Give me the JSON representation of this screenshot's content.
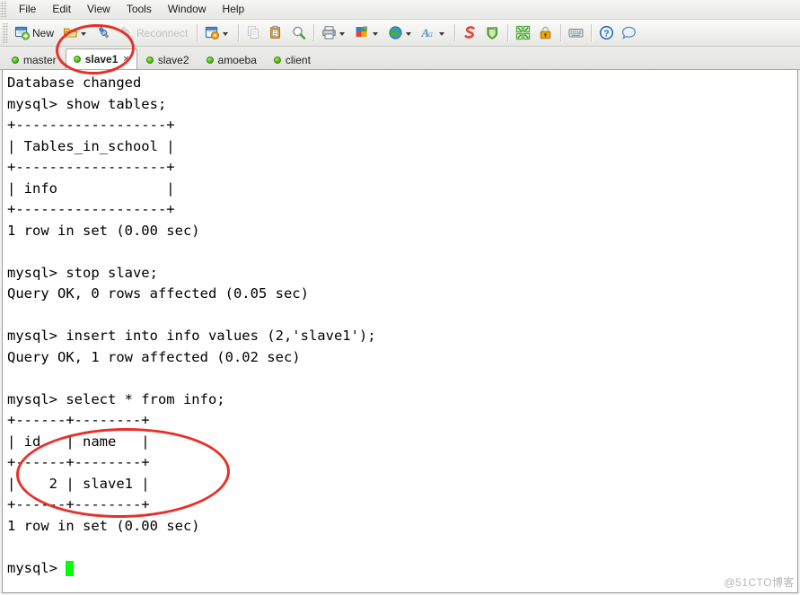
{
  "menubar": {
    "items": [
      {
        "label": "File"
      },
      {
        "label": "Edit"
      },
      {
        "label": "View"
      },
      {
        "label": "Tools"
      },
      {
        "label": "Window"
      },
      {
        "label": "Help"
      }
    ]
  },
  "toolbar": {
    "new_label": "New",
    "reconnect_label": "Reconnect",
    "icons": [
      "new-session-icon",
      "open-folder-icon",
      "connect-icon",
      "reconnect-icon",
      "properties-icon",
      "copy-icon",
      "paste-icon",
      "find-icon",
      "print-icon",
      "color-scheme-icon",
      "globe-icon",
      "font-icon",
      "script-icon",
      "shield-icon",
      "fullscreen-icon",
      "lock-icon",
      "keyboard-icon",
      "help-icon",
      "chat-icon"
    ]
  },
  "tabs": [
    {
      "label": "master",
      "active": false,
      "status": "connected"
    },
    {
      "label": "slave1",
      "active": true,
      "status": "connected",
      "close": "×"
    },
    {
      "label": "slave2",
      "active": false,
      "status": "connected"
    },
    {
      "label": "amoeba",
      "active": false,
      "status": "connected"
    },
    {
      "label": "client",
      "active": false,
      "status": "connected"
    }
  ],
  "terminal": {
    "prompt": "mysql> ",
    "lines": [
      "Database changed",
      "mysql> show tables;",
      "+------------------+",
      "| Tables_in_school |",
      "+------------------+",
      "| info             |",
      "+------------------+",
      "1 row in set (0.00 sec)",
      "",
      "mysql> stop slave;",
      "Query OK, 0 rows affected (0.05 sec)",
      "",
      "mysql> insert into info values (2,'slave1');",
      "Query OK, 1 row affected (0.02 sec)",
      "",
      "mysql> select * from info;",
      "+------+--------+",
      "| id   | name   |",
      "+------+--------+",
      "|    2 | slave1 |",
      "+------+--------+",
      "1 row in set (0.00 sec)",
      "",
      "mysql> "
    ],
    "text": "Database changed\nmysql> show tables;\n+------------------+\n| Tables_in_school |\n+------------------+\n| info             |\n+------------------+\n1 row in set (0.00 sec)\n\nmysql> stop slave;\nQuery OK, 0 rows affected (0.05 sec)\n\nmysql> insert into info values (2,'slave1');\nQuery OK, 1 row affected (0.02 sec)\n\nmysql> select * from info;\n+------+--------+\n| id   | name   |\n+------+--------+\n|    2 | slave1 |\n+------+--------+\n1 row in set (0.00 sec)\n\nmysql> ",
    "cursor_color": "#00ff00",
    "foreground": "#000000",
    "background": "#ffffff"
  },
  "annotations": [
    {
      "name": "tab-highlight",
      "color": "#e8302a",
      "shape": "ellipse"
    },
    {
      "name": "result-table-highlight",
      "color": "#e8302a",
      "shape": "ellipse"
    }
  ],
  "watermark": {
    "text": "@51CTO博客"
  }
}
